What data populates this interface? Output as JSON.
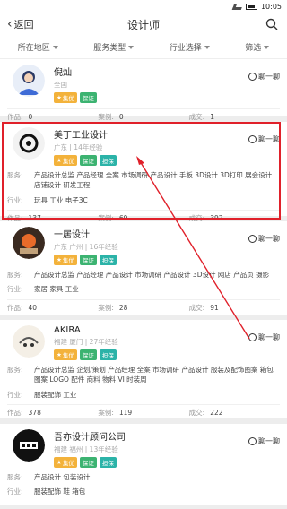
{
  "status": {
    "time": "10:05"
  },
  "header": {
    "back_label": "返回",
    "title": "设计师"
  },
  "filters": [
    "所在地区",
    "服务类型",
    "行业选择",
    "筛选"
  ],
  "cards": [
    {
      "name": "倪灿",
      "sub": "全国",
      "badges": [
        "集优",
        "保证"
      ],
      "chat": "聊一聊",
      "service": "",
      "industry": "",
      "stats": {
        "works_label": "作品:",
        "works": "0",
        "cases_label": "案例:",
        "cases": "0",
        "deals_label": "成交:",
        "deals": "1"
      }
    },
    {
      "name": "美丁工业设计",
      "sub": "广东 | 14年经验",
      "badges": [
        "集优",
        "保证",
        "担保"
      ],
      "chat": "聊一聊",
      "service_label": "服务:",
      "service": "产品设计总监 产品经理 全案 市场调研 产品设计 手板 3D设计 3D打印 展会设计 店铺设计 研发工程",
      "industry_label": "行业:",
      "industry": "玩具 工业 电子3C",
      "stats": {
        "works_label": "作品:",
        "works": "137",
        "cases_label": "案例:",
        "cases": "69",
        "deals_label": "成交:",
        "deals": "392"
      }
    },
    {
      "name": "一居设计",
      "sub": "广东 广州 | 16年经验",
      "badges": [
        "集优",
        "保证",
        "担保"
      ],
      "chat": "聊一聊",
      "service_label": "服务:",
      "service": "产品设计总监 产品经理 产品设计 市场调研 产品设计 3D设计 网店 产品页 摄影",
      "industry_label": "行业:",
      "industry": "家居 家具 工业",
      "stats": {
        "works_label": "作品:",
        "works": "40",
        "cases_label": "案例:",
        "cases": "28",
        "deals_label": "成交:",
        "deals": "91"
      }
    },
    {
      "name": "AKIRA",
      "sub": "福建 厦门 | 27年经验",
      "badges": [
        "集优",
        "保证",
        "担保"
      ],
      "chat": "聊一聊",
      "service_label": "服务:",
      "service": "产品设计总监 企划/策划 产品经理 全案 市场调研 产品设计 服装及配饰图案 箱包图案 LOGO 配件 商料 物料 VI 时装周",
      "industry_label": "行业:",
      "industry": "服装配饰 工业",
      "stats": {
        "works_label": "作品:",
        "works": "378",
        "cases_label": "案例:",
        "cases": "119",
        "deals_label": "成交:",
        "deals": "222"
      }
    },
    {
      "name": "吾亦设计顾问公司",
      "sub": "福建 福州 | 13年经验",
      "badges": [
        "集优",
        "保证",
        "担保"
      ],
      "chat": "聊一聊",
      "service_label": "服务:",
      "service": "产品设计 包装设计",
      "industry_label": "行业:",
      "industry": "服装配饰 鞋 箱包",
      "stats": null
    }
  ],
  "colors": {
    "highlight": "#e0202a",
    "gold": "#f3b23b",
    "green": "#3cb371"
  }
}
